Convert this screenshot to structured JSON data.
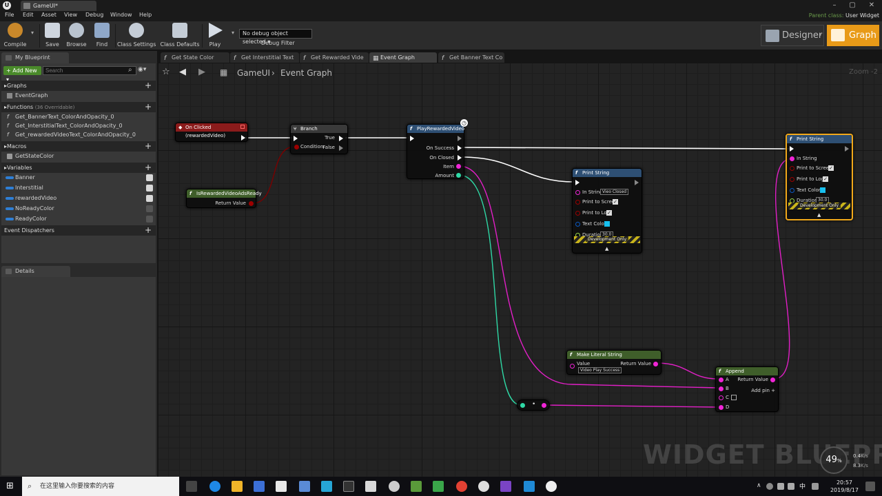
{
  "window": {
    "app_logo": "U",
    "tab_title": "GameUI*",
    "controls": [
      "–",
      "▢",
      "✕"
    ]
  },
  "menu": [
    "File",
    "Edit",
    "Asset",
    "View",
    "Debug",
    "Window",
    "Help"
  ],
  "parent_class": {
    "label": "Parent class:",
    "value": "User Widget"
  },
  "toolbar": {
    "compile": "Compile",
    "save": "Save",
    "browse": "Browse",
    "find": "Find",
    "class_settings": "Class Settings",
    "class_defaults": "Class Defaults",
    "play": "Play",
    "debug_select": "No debug object selected ▾",
    "debug_filter": "Debug Filter",
    "designer": "Designer",
    "graph": "Graph"
  },
  "left_panel": {
    "my_blueprint_tab": "My Blueprint",
    "add_new": "+ Add New ▾",
    "search_placeholder": "Search",
    "graphs": {
      "label": "Graphs",
      "items": [
        "EventGraph"
      ]
    },
    "functions": {
      "label": "Functions",
      "sub": "(36 Overridable)",
      "items": [
        "Get_BannerText_ColorAndOpacity_0",
        "Get_InterstitialText_ColorAndOpacity_0",
        "Get_rewardedVideoText_ColorAndOpacity_0"
      ]
    },
    "macros": {
      "label": "Macros",
      "items": [
        "GetStateColor"
      ]
    },
    "variables": {
      "label": "Variables",
      "items": [
        "Banner",
        "Interstitial",
        "rewardedVideo",
        "NoReadyColor",
        "ReadyColor"
      ]
    },
    "dispatchers": {
      "label": "Event Dispatchers"
    },
    "details_tab": "Details"
  },
  "graph_tabs": [
    "Get State Color",
    "Get Interstitial Text",
    "Get Rewarded Vide",
    "Event Graph",
    "Get Banner Text Co"
  ],
  "graph": {
    "breadcrumb_root": "GameUI",
    "breadcrumb_sep": "›",
    "breadcrumb_leaf": "Event Graph",
    "zoom": "Zoom -2",
    "watermark": "WIDGET BLUEPRINT"
  },
  "nodes": {
    "on_clicked": {
      "title": "On Clicked (rewardedVideo)"
    },
    "branch": {
      "title": "Branch",
      "condition": "Condition",
      "true": "True",
      "false": "False"
    },
    "is_ready": {
      "title": "IsRewardedVideoAdsReady",
      "ret": "Return Value"
    },
    "play_rv": {
      "title": "PlayRewardedVideo",
      "on_success": "On Success",
      "on_closed": "On Closed",
      "item": "Item",
      "amount": "Amount"
    },
    "print1": {
      "title": "Print String",
      "in_string": "In String",
      "in_string_value": "Vieo Closed",
      "print_screen": "Print to Screen",
      "print_log": "Print to Log",
      "text_color": "Text Color",
      "duration": "Duration",
      "duration_value": "30.0",
      "dev": "Development Only"
    },
    "print2": {
      "title": "Print String",
      "in_string": "In String",
      "print_screen": "Print to Screen",
      "print_log": "Print to Log",
      "text_color": "Text Color",
      "duration": "Duration",
      "duration_value": "30.0",
      "dev": "Development Only"
    },
    "make_literal": {
      "title": "Make Literal String",
      "value": "Value",
      "value_text": "Video Play Success",
      "ret": "Return Value"
    },
    "append": {
      "title": "Append",
      "a": "A",
      "b": "B",
      "c": "C",
      "d": "D",
      "ret": "Return Value",
      "add_pin": "Add pin +"
    },
    "convert": {
      "label": "•"
    }
  },
  "taskbar": {
    "search_placeholder": "在这里输入你要搜索的内容",
    "ime": "中",
    "time": "20:57",
    "date": "2019/8/17",
    "perf": "49",
    "perf_unit": "%",
    "net_up": "0.4",
    "net_down": "8.3",
    "net_unit": "K/s"
  },
  "colors": {
    "accent": "#e89a18",
    "exec": "#ffffff",
    "string_pin": "#f025d6",
    "int_pin": "#2fd9a6",
    "bool_pin": "#9c0000",
    "event_head": "#8b1b1b",
    "func_head": "#2e4f73",
    "pure_head": "#3f5e2a"
  }
}
